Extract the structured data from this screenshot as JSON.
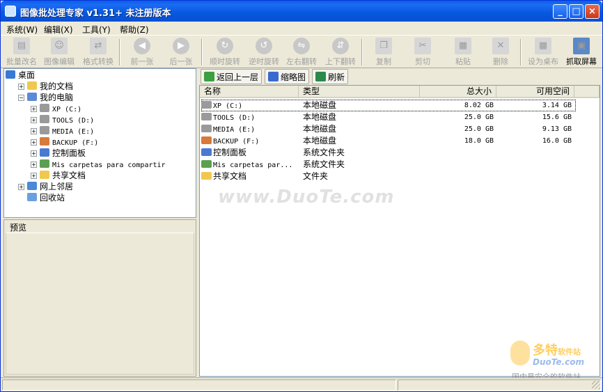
{
  "window": {
    "title": "图像批处理专家 v1.31+ 未注册版本",
    "minimize": "_",
    "maximize": "□",
    "close": "×"
  },
  "menu": [
    {
      "label": "系统(W)"
    },
    {
      "label": "编辑(X)"
    },
    {
      "label": "工具(Y)"
    },
    {
      "label": "帮助(Z)"
    }
  ],
  "toolbar": [
    {
      "label": "批量改名",
      "icon": "file-rename-icon",
      "glyph": "▤",
      "enabled": false
    },
    {
      "label": "图像编辑",
      "icon": "portrait-icon",
      "glyph": "☺",
      "enabled": false
    },
    {
      "label": "格式转换",
      "icon": "format-convert-icon",
      "glyph": "⇄",
      "enabled": false
    },
    {
      "label": "前一张",
      "icon": "prev-arrow-icon",
      "glyph": "◀",
      "enabled": false
    },
    {
      "label": "后一张",
      "icon": "next-arrow-icon",
      "glyph": "▶",
      "enabled": false
    },
    {
      "label": "顺时旋转",
      "icon": "rotate-cw-icon",
      "glyph": "↻",
      "enabled": false
    },
    {
      "label": "逆时旋转",
      "icon": "rotate-ccw-icon",
      "glyph": "↺",
      "enabled": false
    },
    {
      "label": "左右翻转",
      "icon": "flip-horizontal-icon",
      "glyph": "⇋",
      "enabled": false
    },
    {
      "label": "上下翻转",
      "icon": "flip-vertical-icon",
      "glyph": "⇵",
      "enabled": false
    },
    {
      "label": "复制",
      "icon": "copy-icon",
      "glyph": "❐",
      "enabled": false
    },
    {
      "label": "剪切",
      "icon": "scissors-icon",
      "glyph": "✂",
      "enabled": false
    },
    {
      "label": "粘贴",
      "icon": "paste-icon",
      "glyph": "▦",
      "enabled": false
    },
    {
      "label": "删除",
      "icon": "delete-x-icon",
      "glyph": "✕",
      "enabled": false
    },
    {
      "label": "设为桌布",
      "icon": "wallpaper-icon",
      "glyph": "▦",
      "enabled": false
    },
    {
      "label": "抓取屏幕",
      "icon": "screen-capture-icon",
      "glyph": "▣",
      "enabled": true
    }
  ],
  "tree": [
    {
      "label": "桌面",
      "level": 0,
      "expander": "",
      "icon": "desktop-icon",
      "color": "#3a78d8"
    },
    {
      "label": "我的文档",
      "level": 1,
      "expander": "+",
      "icon": "my-documents-icon",
      "color": "#f0c850"
    },
    {
      "label": "我的电脑",
      "level": 1,
      "expander": "−",
      "icon": "my-computer-icon",
      "color": "#5a8ad8"
    },
    {
      "label": "XP (C:)",
      "level": 2,
      "expander": "+",
      "icon": "hard-drive-icon",
      "color": "#9a9a9a",
      "mono": true
    },
    {
      "label": "TOOLS (D:)",
      "level": 2,
      "expander": "+",
      "icon": "hard-drive-icon",
      "color": "#9a9a9a",
      "mono": true
    },
    {
      "label": "MEDIA (E:)",
      "level": 2,
      "expander": "+",
      "icon": "hard-drive-icon",
      "color": "#9a9a9a",
      "mono": true
    },
    {
      "label": "BACKUP (F:)",
      "level": 2,
      "expander": "+",
      "icon": "hard-drive-icon",
      "color": "#d87a3a",
      "mono": true
    },
    {
      "label": "控制面板",
      "level": 2,
      "expander": "+",
      "icon": "control-panel-icon",
      "color": "#4a7ad0"
    },
    {
      "label": "Mis carpetas para compartir",
      "level": 2,
      "expander": "+",
      "icon": "shared-folders-icon",
      "color": "#5aa050",
      "mono": true
    },
    {
      "label": "共享文档",
      "level": 2,
      "expander": "+",
      "icon": "folder-icon",
      "color": "#f0c850"
    },
    {
      "label": "网上邻居",
      "level": 1,
      "expander": "+",
      "icon": "network-icon",
      "color": "#4a8ad8"
    },
    {
      "label": "回收站",
      "level": 1,
      "expander": "",
      "icon": "recycle-bin-icon",
      "color": "#6aa0e0"
    }
  ],
  "preview": {
    "label": "预览"
  },
  "right_toolbar": [
    {
      "label": "返回上一层",
      "icon": "up-folder-icon",
      "color": "#3aa040"
    },
    {
      "label": "缩略图",
      "icon": "thumbnails-icon",
      "color": "#3a6ad0"
    },
    {
      "label": "刷新",
      "icon": "refresh-icon",
      "color": "#2a8a4a"
    }
  ],
  "list": {
    "headers": [
      "名称",
      "类型",
      "总大小",
      "可用空间"
    ],
    "rows": [
      {
        "name": "XP (C:)",
        "type": "本地磁盘",
        "total": "8.02 GB",
        "free": "3.14 GB",
        "icon": "hard-drive-icon",
        "color": "#9a9a9a",
        "mono": true,
        "selected": true
      },
      {
        "name": "TOOLS (D:)",
        "type": "本地磁盘",
        "total": "25.0 GB",
        "free": "15.6 GB",
        "icon": "hard-drive-icon",
        "color": "#9a9a9a",
        "mono": true
      },
      {
        "name": "MEDIA (E:)",
        "type": "本地磁盘",
        "total": "25.0 GB",
        "free": "9.13 GB",
        "icon": "hard-drive-icon",
        "color": "#9a9a9a",
        "mono": true
      },
      {
        "name": "BACKUP (F:)",
        "type": "本地磁盘",
        "total": "18.0 GB",
        "free": "16.0 GB",
        "icon": "hard-drive-icon",
        "color": "#d87a3a",
        "mono": true
      },
      {
        "name": "控制面板",
        "type": "系统文件夹",
        "total": "",
        "free": "",
        "icon": "control-panel-icon",
        "color": "#4a7ad0"
      },
      {
        "name": "Mis carpetas par...",
        "type": "系统文件夹",
        "total": "",
        "free": "",
        "icon": "shared-folders-icon",
        "color": "#5aa050",
        "mono": true
      },
      {
        "name": "共享文档",
        "type": "文件夹",
        "total": "",
        "free": "",
        "icon": "folder-icon",
        "color": "#f0c850"
      }
    ]
  },
  "watermark": {
    "main": "www.DuoTe.com",
    "brand": "多特",
    "brand_small": "软件站",
    "domain": "DuoTe.com",
    "slogan": "国内最安全的软件站"
  }
}
